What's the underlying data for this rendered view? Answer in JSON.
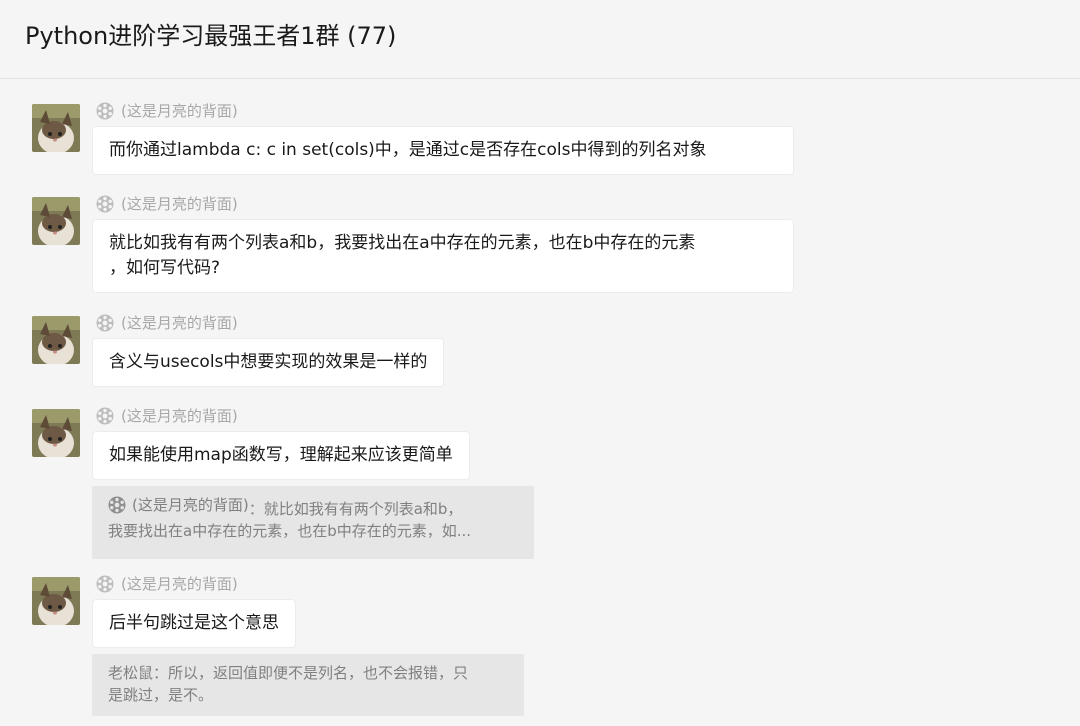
{
  "header": {
    "title": "Python进阶学习最强王者1群 (77)"
  },
  "messages": [
    {
      "sender": "(这是月亮的背面)",
      "text": "而你通过lambda c: c in set(cols)中，是通过c是否存在cols中得到的列名对象"
    },
    {
      "sender": "(这是月亮的背面)",
      "text": "就比如我有有两个列表a和b，我要找出在a中存在的元素，也在b中存在的元素\n，如何写代码?"
    },
    {
      "sender": "(这是月亮的背面)",
      "text": "含义与usecols中想要实现的效果是一样的"
    },
    {
      "sender": "(这是月亮的背面)",
      "text": "如果能使用map函数写，理解起来应该更简单",
      "quote": {
        "sender": "(这是月亮的背面)",
        "line1": "：就比如我有有两个列表a和b，",
        "line2": "我要找出在a中存在的元素，也在b中存在的元素，如..."
      }
    },
    {
      "sender": "(这是月亮的背面)",
      "text": "后半句跳过是这个意思",
      "quote": {
        "line1": "老松鼠：所以，返回值即便不是列名，也不会报错，只",
        "line2": "是跳过，是不。"
      }
    }
  ],
  "colors": {
    "background": "#f5f5f5",
    "bubble": "#ffffff",
    "quote_bg": "#e6e6e6",
    "sender_text": "#a8a8a8"
  },
  "icons": {
    "sender_icon": "globe-icon",
    "avatar": "cat-avatar"
  }
}
